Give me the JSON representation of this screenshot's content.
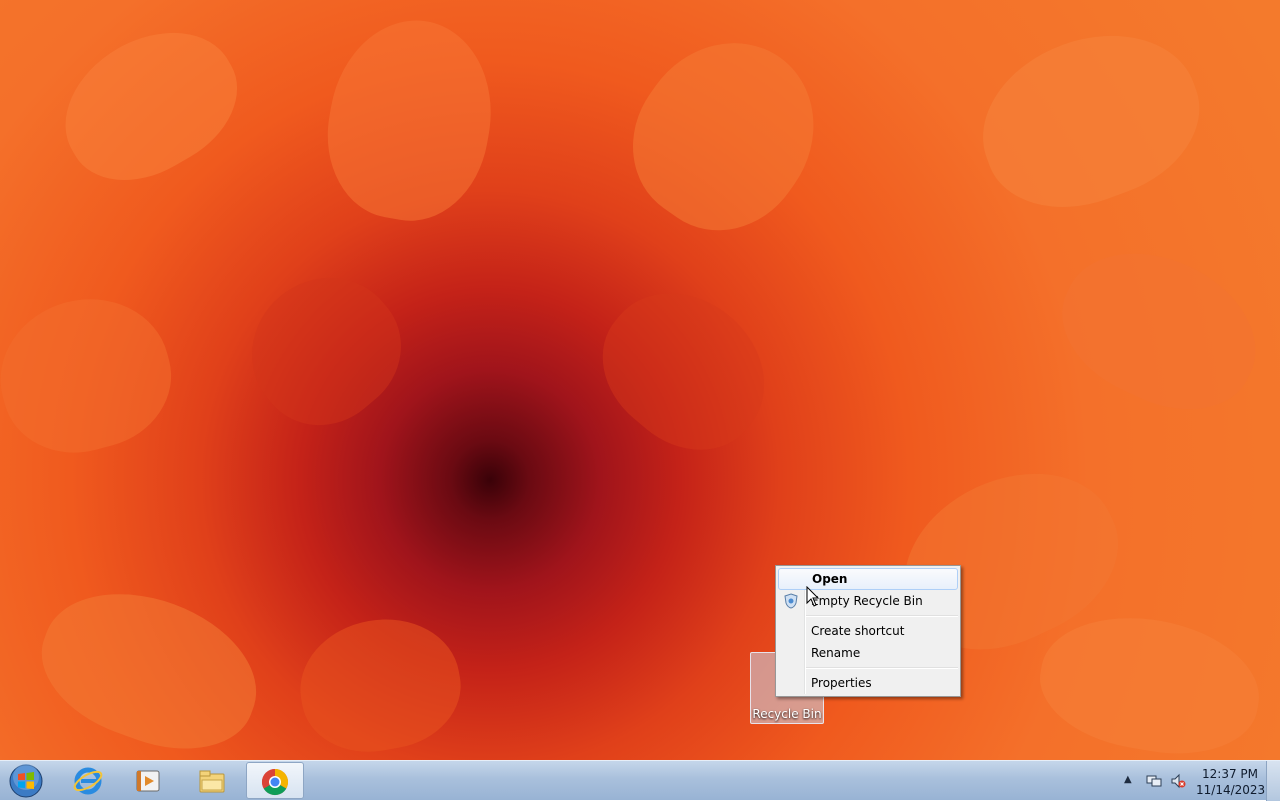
{
  "desktop": {
    "icons": [
      {
        "label": "Recycle Bin"
      }
    ]
  },
  "context_menu": {
    "items": [
      {
        "label": "Open",
        "bold": true,
        "hover": true
      },
      {
        "label": "Empty Recycle Bin",
        "icon": "shield-icon"
      },
      {
        "separator": true
      },
      {
        "label": "Create shortcut"
      },
      {
        "label": "Rename"
      },
      {
        "separator": true
      },
      {
        "label": "Properties"
      }
    ]
  },
  "taskbar": {
    "start_icon": "windows-start-orb-icon",
    "pinned": [
      {
        "name": "internet-explorer-icon"
      },
      {
        "name": "media-player-icon"
      },
      {
        "name": "file-explorer-icon"
      },
      {
        "name": "chrome-icon",
        "active": true
      }
    ],
    "tray": {
      "icons": [
        "show-hidden-icons-arrow",
        "network-icon",
        "volume-muted-icon"
      ],
      "time": "12:37 PM",
      "date": "11/14/2023"
    }
  },
  "colors": {
    "wallpaper_center": "#3a0208",
    "wallpaper_mid": "#c42218",
    "wallpaper_outer": "#f47a2c",
    "taskbar": "#a9c0dc",
    "menu_bg": "#f0f0f0",
    "menu_hover_border": "#aecff7"
  }
}
